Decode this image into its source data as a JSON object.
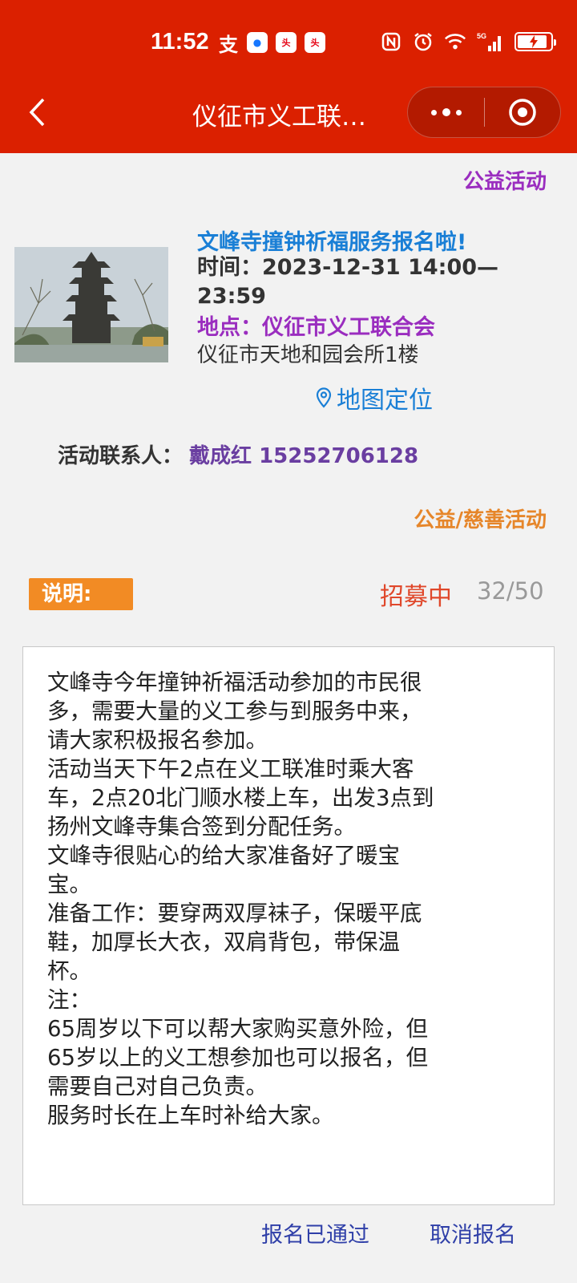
{
  "status_bar": {
    "time": "11:52",
    "app_icons": [
      "alipay-icon",
      "app-blue-icon",
      "toutiao-icon",
      "toutiao-icon-2"
    ],
    "system_icons": [
      "nfc-icon",
      "alarm-icon",
      "wifi-icon",
      "5g-signal-icon",
      "battery-icon"
    ],
    "network": "5G"
  },
  "nav": {
    "title": "仪征市义工联…"
  },
  "category_tag": "公益活动",
  "activity": {
    "title": "文峰寺撞钟祈福服务报名啦!",
    "time": "时间：2023-12-31 14:00—23:59",
    "place": "地点：仪征市义工联合会",
    "address": "仪征市天地和园会所1楼",
    "map_label": "地图定位"
  },
  "contact": {
    "label": "活动联系人：",
    "value": "戴成红 15252706128"
  },
  "type_tag": "公益/慈善活动",
  "description": {
    "badge": "说明:",
    "status": "招募中",
    "count": "32/50",
    "lines": [
      "文峰寺今年撞钟祈福活动参加的市民很",
      "多，需要大量的义工参与到服务中来，",
      "请大家积极报名参加。",
      "活动当天下午2点在义工联准时乘大客",
      "车，2点20北门顺水楼上车，出发3点到",
      "扬州文峰寺集合签到分配任务。",
      "文峰寺很贴心的给大家准备好了暖宝",
      "宝。",
      "准备工作：要穿两双厚袜子，保暖平底",
      "鞋，加厚长大衣，双肩背包，带保温",
      "杯。",
      "注：",
      "65周岁以下可以帮大家购买意外险，但",
      "65岁以上的义工想参加也可以报名，但",
      "需要自己对自己负责。",
      "服务时长在上车时补给大家。"
    ]
  },
  "actions": {
    "approved": "报名已通过",
    "cancel": "取消报名"
  },
  "colors": {
    "header": "#db2000",
    "title_blue": "#1a7fd6",
    "purple": "#9a2dbf",
    "orange": "#f28b24",
    "status_red": "#e0482b"
  }
}
